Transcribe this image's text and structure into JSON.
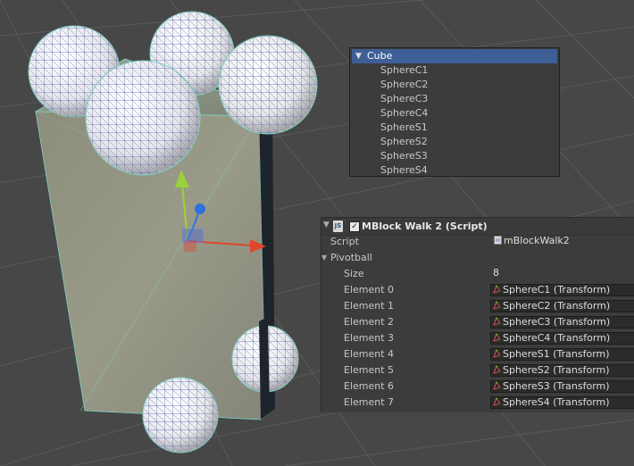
{
  "hierarchy": {
    "root": "Cube",
    "children": [
      "SphereC1",
      "SphereC2",
      "SphereC3",
      "SphereC4",
      "SphereS1",
      "SphereS2",
      "SphereS3",
      "SphereS4"
    ]
  },
  "inspector": {
    "component_title": "MBlock Walk 2 (Script)",
    "enabled": true,
    "script_label": "Script",
    "script_value": "mBlockWalk2",
    "pivotball_label": "Pivotball",
    "size_label": "Size",
    "size_value": "8",
    "elements": [
      {
        "label": "Element 0",
        "value": "SphereC1 (Transform)"
      },
      {
        "label": "Element 1",
        "value": "SphereC2 (Transform)"
      },
      {
        "label": "Element 2",
        "value": "SphereC3 (Transform)"
      },
      {
        "label": "Element 3",
        "value": "SphereC4 (Transform)"
      },
      {
        "label": "Element 4",
        "value": "SphereS1 (Transform)"
      },
      {
        "label": "Element 5",
        "value": "SphereS2 (Transform)"
      },
      {
        "label": "Element 6",
        "value": "SphereS3 (Transform)"
      },
      {
        "label": "Element 7",
        "value": "SphereS4 (Transform)"
      }
    ]
  },
  "colors": {
    "scene_background": "#474747",
    "selection_blue": "#3e5f96",
    "gizmo_y": "#9ad23a",
    "gizmo_x": "#e0462a",
    "gizmo_z": "#2f6fe0"
  }
}
